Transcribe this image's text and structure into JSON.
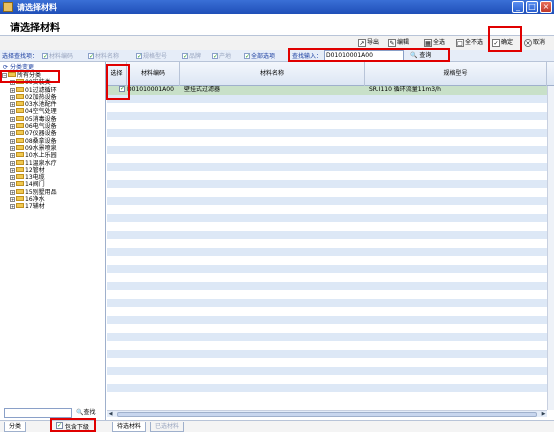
{
  "window": {
    "title": "请选择材料",
    "buttons": [
      "_",
      "□",
      "×"
    ]
  },
  "header": {
    "title": "请选择材料"
  },
  "toolbar": {
    "export": "导出",
    "edit": "编辑",
    "select_all": "全选",
    "select_none": "全不选",
    "confirm": "确定",
    "cancel": "取消"
  },
  "filterbar": {
    "label": "选择查找项：",
    "options": [
      {
        "label": "材料编码",
        "checked": true,
        "active": false
      },
      {
        "label": "材料名称",
        "checked": true,
        "active": false
      },
      {
        "label": "规格型号",
        "checked": true,
        "active": false
      },
      {
        "label": "品牌",
        "checked": true,
        "active": false
      },
      {
        "label": "产地",
        "checked": true,
        "active": false
      },
      {
        "label": "全部选项",
        "checked": true,
        "active": true
      }
    ],
    "search_label": "查找输入：",
    "search_value": "D01010001A00",
    "search_button": "查询"
  },
  "left_panel": {
    "header": "分类变更",
    "root": "所有分类",
    "items": [
      "00安装类",
      "01过滤循环",
      "02加热设备",
      "03水池配件",
      "04空气处理",
      "05消毒设备",
      "06电气设备",
      "07仪器设备",
      "08桑拿设备",
      "09水景喷泉",
      "10水上乐园",
      "11温泉水疗",
      "12管材",
      "13电缆",
      "14阀门",
      "15别墅用品",
      "16净水",
      "17辅材"
    ],
    "search_button": "查找",
    "tab": "分类",
    "include_sub": "包含下级"
  },
  "grid": {
    "columns": [
      "选择",
      "材料编码",
      "材料名称",
      "规格型号"
    ],
    "rows": [
      {
        "selected": true,
        "code": "D01010001A00",
        "name": "壁挂式过滤器",
        "spec": "SR.I110  循环流量11m3/h"
      }
    ],
    "empty_rows": 36
  },
  "bottom_tabs": [
    "待选材料",
    "已选材料"
  ],
  "colors": {
    "title_bar": "#1f4fb8",
    "alt_row": "#dde8f6",
    "highlight": "#e00000",
    "selected_row": "#c8e0c8"
  }
}
